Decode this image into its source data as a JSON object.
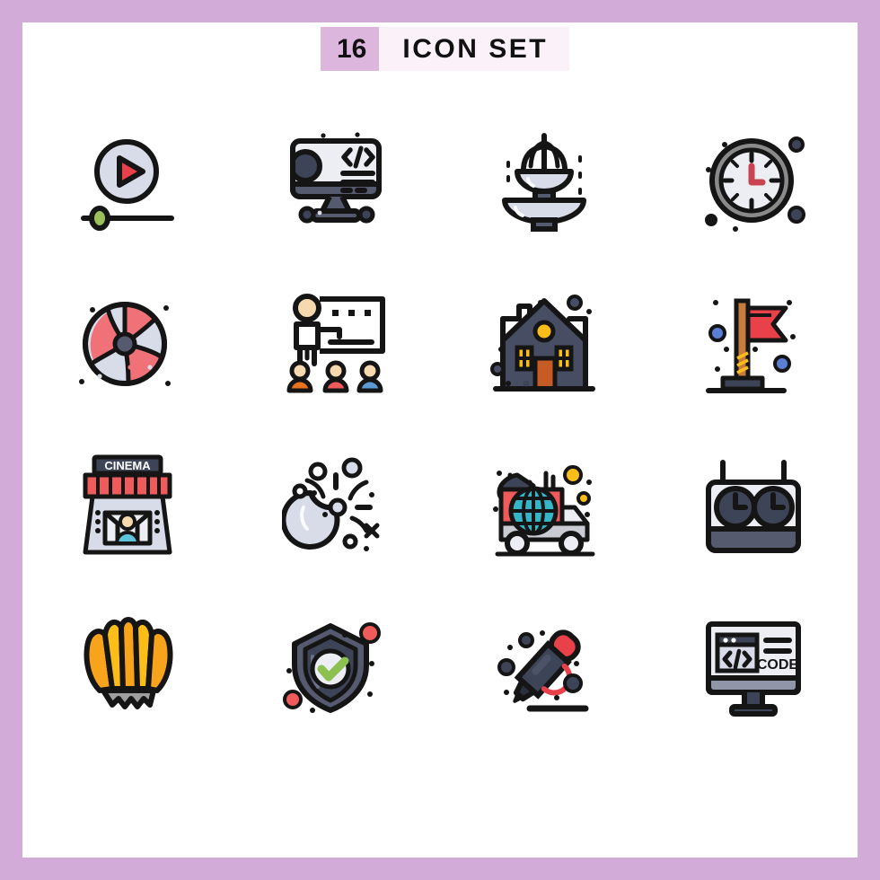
{
  "poster": {
    "border_color": "#d2abd8",
    "background_color": "#ffffff"
  },
  "header": {
    "count": "16",
    "count_bg": "#ddb6dd",
    "title": "ICON SET",
    "title_bg": "#fbf1f8",
    "text_color": "#111111"
  },
  "palette": {
    "outline": "#151515",
    "light_blue_grey": "#d8dbe8",
    "pale_grey": "#eceef3",
    "slate": "#555a6e",
    "dark_navy": "#3e4457",
    "red": "#e8414a",
    "coral": "#ef5b5b",
    "salmon": "#f07178",
    "orange": "#c75b26",
    "amber": "#f7c52b",
    "yellow": "#fbbe18",
    "green": "#8cc152",
    "olive": "#9bbf5a",
    "blue": "#5b9bd5",
    "teal": "#35b5c6",
    "skin": "#f7d9b0",
    "grey": "#8a8a8a"
  },
  "icons": [
    {
      "index": 1,
      "name": "video-player-icon",
      "label": "Video Player",
      "description": "Play button inside a circle above a progress slider",
      "colors": [
        "#d8dbe8",
        "#e8414a",
        "#9bbf5a"
      ]
    },
    {
      "index": 2,
      "name": "web-development-monitor-icon",
      "label": "Web Development",
      "description": "Desktop monitor showing a gear and code brackets",
      "code_symbol": "</>",
      "colors": [
        "#eceef3",
        "#555a6e",
        "#3e4457"
      ]
    },
    {
      "index": 3,
      "name": "fountain-icon",
      "label": "Fountain",
      "description": "Two tier water fountain with spraying water",
      "colors": [
        "#d8dbe8",
        "#555a6e"
      ]
    },
    {
      "index": 4,
      "name": "wall-clock-icon",
      "label": "Clock",
      "description": "Round wall clock with tick marks and red hands",
      "colors": [
        "#eceef3",
        "#8a8a8a",
        "#e8414a"
      ]
    },
    {
      "index": 5,
      "name": "beach-ball-icon",
      "label": "Beach Ball",
      "description": "Striped beach ball in red and white",
      "colors": [
        "#f07178",
        "#d8dbe8",
        "#555a6e"
      ]
    },
    {
      "index": 6,
      "name": "presentation-training-icon",
      "label": "Training Presentation",
      "description": "Presenter at a whiteboard with three seated attendees",
      "colors": [
        "#f7d9b0",
        "#e8731f",
        "#ef5b5b",
        "#5b9bd5"
      ]
    },
    {
      "index": 7,
      "name": "night-house-icon",
      "label": "House at Night",
      "description": "Dark house with glowing yellow windows and orange door",
      "colors": [
        "#474e63",
        "#fbbe18",
        "#c75b26"
      ]
    },
    {
      "index": 8,
      "name": "flag-pole-icon",
      "label": "Flag",
      "description": "Red flag on a wooden pole with a dark base",
      "colors": [
        "#e8414a",
        "#c57c3c",
        "#3e4457",
        "#5b7fd5"
      ]
    },
    {
      "index": 9,
      "name": "cinema-ticket-booth-icon",
      "label": "Cinema Ticket Booth",
      "sign_text": "CINEMA",
      "description": "Ticket booth with striped awning and a cashier",
      "colors": [
        "#d8dbe8",
        "#ef5b5b",
        "#35b5c6"
      ]
    },
    {
      "index": 10,
      "name": "crescent-moon-stars-icon",
      "label": "Night Sky",
      "description": "Crescent moon surrounded by sparkles and stars",
      "colors": [
        "#d8dbe8",
        "#151515"
      ]
    },
    {
      "index": 11,
      "name": "news-broadcast-van-icon",
      "label": "Broadcast Van",
      "description": "Satellite news van with a globe on the side",
      "colors": [
        "#ef5b5b",
        "#35b5c6",
        "#c9ccd3",
        "#fbbe18"
      ]
    },
    {
      "index": 12,
      "name": "chess-clock-icon",
      "label": "Chess Clock",
      "description": "Twin dial timer box with two antennas",
      "colors": [
        "#eceef3",
        "#555a6e",
        "#3e4457"
      ]
    },
    {
      "index": 13,
      "name": "shuttlecock-icon",
      "label": "Shuttlecock",
      "description": "Badminton shuttlecock with amber feathers",
      "colors": [
        "#fbbe18",
        "#f29b23",
        "#9e9e9e"
      ]
    },
    {
      "index": 14,
      "name": "security-shield-check-icon",
      "label": "Security Shield",
      "description": "Dark shield with a green check mark badge",
      "colors": [
        "#555a6e",
        "#3e4457",
        "#8cc152",
        "#ef5b5b"
      ]
    },
    {
      "index": 15,
      "name": "highlighter-marker-icon",
      "label": "Highlighter",
      "description": "Marker pen with red cap drawing a line",
      "colors": [
        "#e8414a",
        "#3e4457",
        "#2b3040"
      ]
    },
    {
      "index": 16,
      "name": "code-monitor-icon",
      "label": "Code",
      "screen_text": "CODE",
      "code_symbol": "</>",
      "description": "Monitor showing a code window labelled CODE",
      "colors": [
        "#eceef3",
        "#d8dbe8",
        "#3e4457"
      ]
    }
  ]
}
